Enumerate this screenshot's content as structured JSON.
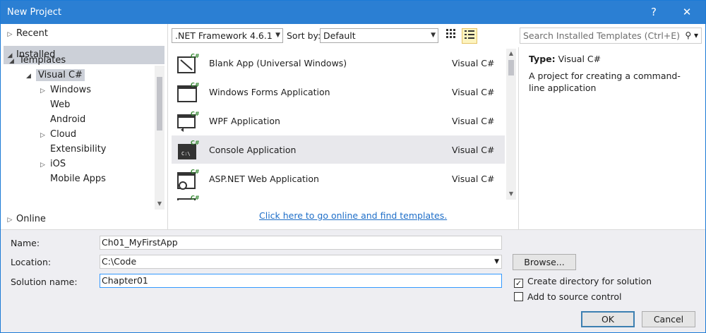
{
  "window": {
    "title": "New Project",
    "help_glyph": "?",
    "close_glyph": "✕"
  },
  "left_panel": {
    "recent": "Recent",
    "installed": "Installed",
    "online": "Online",
    "tree": [
      {
        "label": "Templates",
        "arrow": "◢"
      },
      {
        "label": "Visual C#",
        "arrow": "◢",
        "selected": true
      },
      {
        "label": "Windows",
        "arrow": "▷"
      },
      {
        "label": "Web",
        "arrow": ""
      },
      {
        "label": "Android",
        "arrow": ""
      },
      {
        "label": "Cloud",
        "arrow": "▷"
      },
      {
        "label": "Extensibility",
        "arrow": ""
      },
      {
        "label": "iOS",
        "arrow": "▷"
      },
      {
        "label": "Mobile Apps",
        "arrow": ""
      }
    ]
  },
  "toolbar": {
    "framework": ".NET Framework 4.6.1",
    "sort_label": "Sort by:",
    "sort_value": "Default",
    "search_placeholder": "Search Installed Templates (Ctrl+E)"
  },
  "templates": [
    {
      "name": "Blank App (Universal Windows)",
      "lang": "Visual C#",
      "icon": "universal-app-icon"
    },
    {
      "name": "Windows Forms Application",
      "lang": "Visual C#",
      "icon": "windows-forms-icon"
    },
    {
      "name": "WPF Application",
      "lang": "Visual C#",
      "icon": "wpf-icon"
    },
    {
      "name": "Console Application",
      "lang": "Visual C#",
      "icon": "console-icon",
      "selected": true
    },
    {
      "name": "ASP.NET Web Application",
      "lang": "Visual C#",
      "icon": "aspnet-icon"
    }
  ],
  "online_link": "Click here to go online and find templates.",
  "details": {
    "type_label": "Type:",
    "type_value": "Visual C#",
    "description": "A project for creating a command-line application"
  },
  "form": {
    "name_label": "Name:",
    "name_value": "Ch01_MyFirstApp",
    "location_label": "Location:",
    "location_value": "C:\\Code",
    "solution_label": "Solution name:",
    "solution_value": "Chapter01",
    "browse": "Browse...",
    "create_dir": "Create directory for solution",
    "create_dir_checked": true,
    "source_control": "Add to source control",
    "source_control_checked": false,
    "ok": "OK",
    "cancel": "Cancel"
  },
  "colors": {
    "accent": "#2b7fd3",
    "link": "#1e6ec8",
    "selection": "#ccd0d8"
  }
}
